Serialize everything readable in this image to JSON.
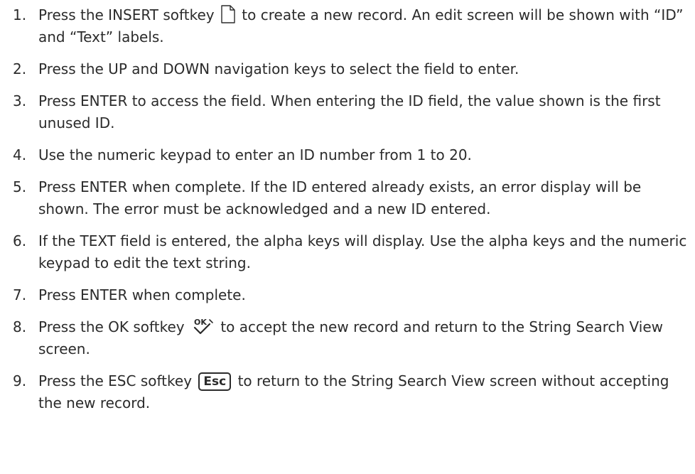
{
  "steps": [
    {
      "number": "1.",
      "before": "Press the INSERT softkey",
      "icon": "insert-document-icon",
      "after": "to create a new record. An edit screen will be shown with “ID” and “Text” labels."
    },
    {
      "number": "2.",
      "text": "Press the UP and DOWN navigation keys to select the field to enter."
    },
    {
      "number": "3.",
      "text": "Press ENTER to access the field. When entering the ID field, the value shown is the first unused ID."
    },
    {
      "number": "4.",
      "text": "Use the numeric keypad to enter an ID number from 1 to 20."
    },
    {
      "number": "5.",
      "text": "Press ENTER when complete. If the ID entered already exists, an error display will be shown. The error must be acknowledged and a new ID entered."
    },
    {
      "number": "6.",
      "text": "If the TEXT field is entered, the alpha keys will display. Use the alpha keys and the numeric keypad to edit the text string."
    },
    {
      "number": "7.",
      "text": "Press ENTER when complete."
    },
    {
      "number": "8.",
      "before": "Press the OK softkey",
      "icon": "ok-checkmark-icon",
      "icon_text": "OK",
      "after": "to accept the new record and return to the String Search View screen."
    },
    {
      "number": "9.",
      "before": "Press the ESC softkey",
      "key_label": "Esc",
      "after": "to return to the String Search View screen without accepting the new record."
    }
  ]
}
